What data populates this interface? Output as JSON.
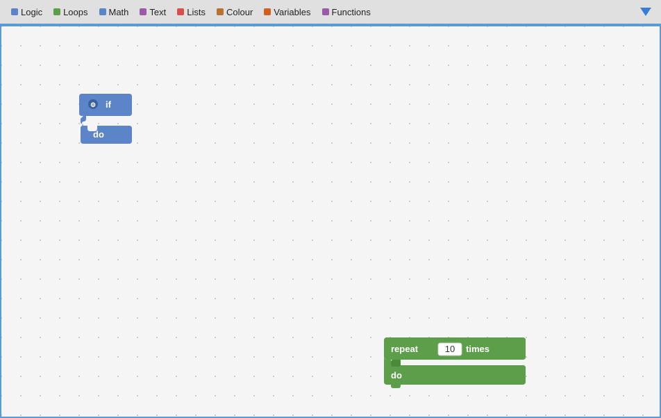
{
  "toolbar": {
    "items": [
      {
        "id": "logic",
        "label": "Logic",
        "color": "#5b85c8"
      },
      {
        "id": "loops",
        "label": "Loops",
        "color": "#5c9e4a"
      },
      {
        "id": "math",
        "label": "Math",
        "color": "#5b85c8"
      },
      {
        "id": "text",
        "label": "Text",
        "color": "#9c5ba8"
      },
      {
        "id": "lists",
        "label": "Lists",
        "color": "#d94e4e"
      },
      {
        "id": "colour",
        "label": "Colour",
        "color": "#b87333"
      },
      {
        "id": "variables",
        "label": "Variables",
        "color": "#d06020"
      },
      {
        "id": "functions",
        "label": "Functions",
        "color": "#9c5ba8"
      }
    ]
  },
  "if_block": {
    "top_label": "if",
    "bottom_label": "do"
  },
  "repeat_block": {
    "repeat_label": "repeat",
    "number_value": "10",
    "times_label": "times",
    "do_label": "do"
  }
}
